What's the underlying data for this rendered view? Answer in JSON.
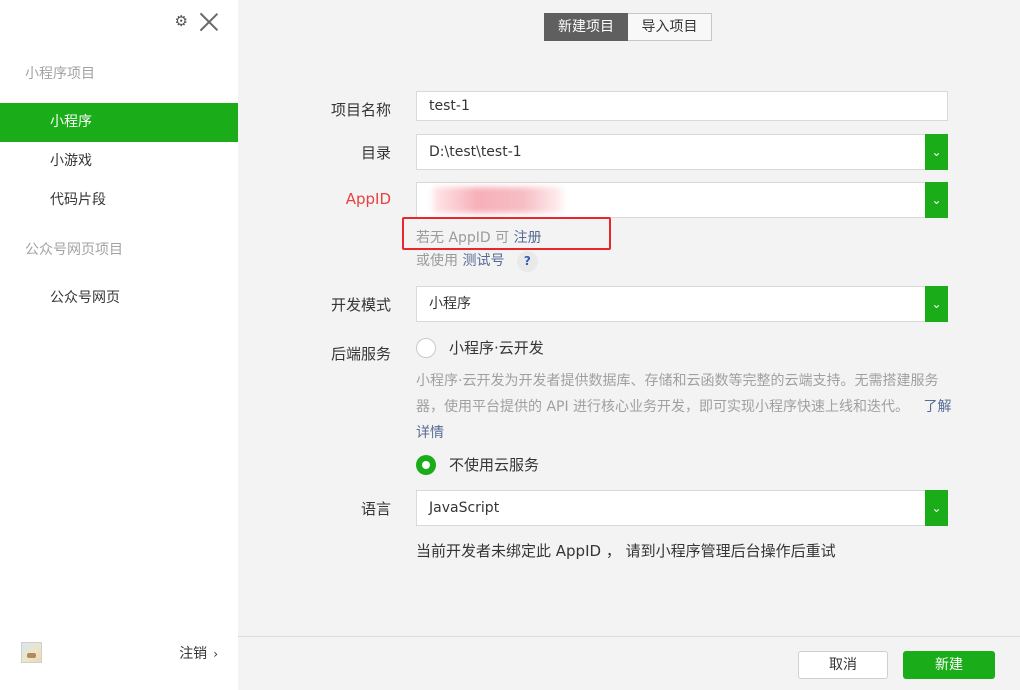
{
  "sidebar": {
    "sections": [
      {
        "title": "小程序项目",
        "items": [
          "小程序",
          "小游戏",
          "代码片段"
        ]
      },
      {
        "title": "公众号网页项目",
        "items": [
          "公众号网页"
        ]
      }
    ],
    "active_item": "小程序",
    "logout_label": "注销",
    "logout_chevron": "›"
  },
  "tabs": [
    "新建项目",
    "导入项目"
  ],
  "active_tab": "新建项目",
  "form": {
    "project_name": {
      "label": "项目名称",
      "value": "test-1"
    },
    "directory": {
      "label": "目录",
      "value": "D:\\test\\test-1"
    },
    "appid": {
      "label": "AppID",
      "value": "",
      "no_appid_text": "若无 AppID 可",
      "register_link": "注册",
      "or_use_text": "或使用",
      "test_account_link": "测试号",
      "help": "?"
    },
    "dev_mode": {
      "label": "开发模式",
      "value": "小程序"
    },
    "backend": {
      "label": "后端服务",
      "option_cloud": "小程序·云开发",
      "cloud_description": "小程序·云开发为开发者提供数据库、存储和云函数等完整的云端支持。无需搭建服务器，使用平台提供的 API 进行核心业务开发，即可实现小程序快速上线和迭代。",
      "learn_more_link": "了解详情",
      "option_no_cloud": "不使用云服务",
      "selected": "不使用云服务"
    },
    "language": {
      "label": "语言",
      "value": "JavaScript"
    },
    "notice": "当前开发者未绑定此 AppID ， 请到小程序管理后台操作后重试"
  },
  "footer": {
    "cancel_label": "取消",
    "create_label": "新建"
  },
  "colors": {
    "accent": "#1aad19",
    "link": "#576b95",
    "error": "#e64340",
    "highlight_box": "#e8262b"
  },
  "icons": {
    "settings": "gear-icon",
    "close": "close-icon",
    "dropdown": "chevron-down-icon",
    "help": "question-icon"
  }
}
